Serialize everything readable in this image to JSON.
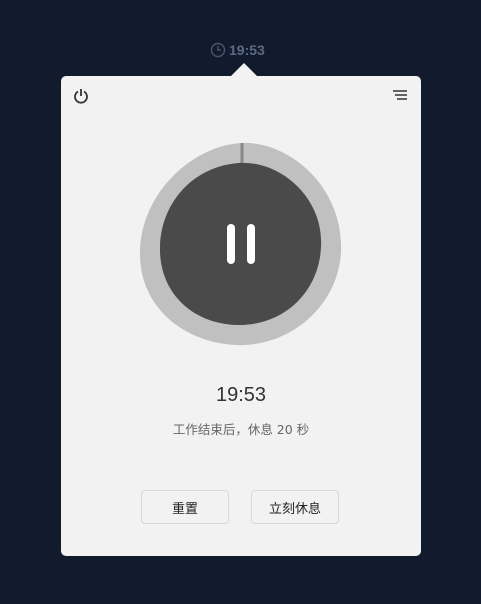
{
  "tray": {
    "clock_icon": "clock-icon",
    "time": "19:53"
  },
  "panel": {
    "power_icon": "power-icon",
    "menu_icon": "menu-icon",
    "pause_icon": "pause-icon",
    "progress": 0.01,
    "time": "19:53",
    "message": "工作结束后，休息 20 秒",
    "buttons": {
      "reset": "重置",
      "rest_now": "立刻休息"
    },
    "colors": {
      "outer": "#c0c0c0",
      "inner": "#4a4a4a"
    }
  }
}
